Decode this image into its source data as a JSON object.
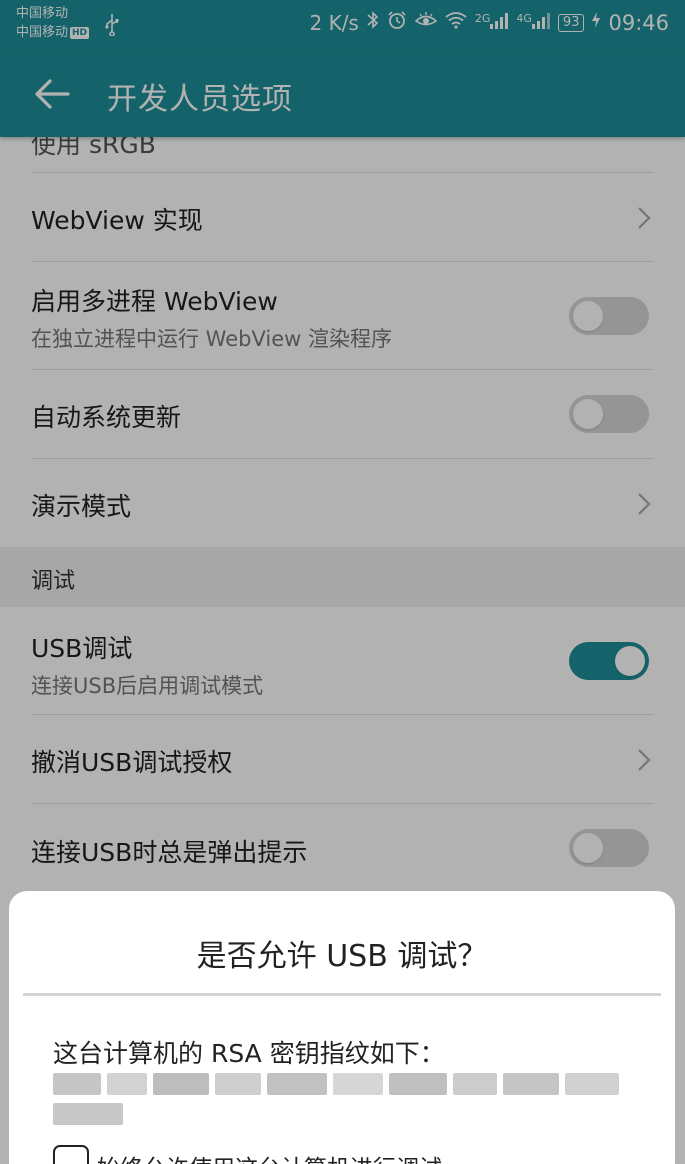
{
  "status_bar": {
    "carrier_1": "中国移动",
    "carrier_2": "中国移动",
    "hd_badge": "HD",
    "net_speed": "2 K/s",
    "signal_1_label": "2G",
    "signal_2_label": "4G",
    "battery": "93",
    "time": "09:46"
  },
  "app_bar": {
    "title": "开发人员选项"
  },
  "settings": {
    "partial_row": "使用 sRGB",
    "webview_impl": "WebView 实现",
    "multiprocess": {
      "title": "启用多进程 WebView",
      "subtitle": "在独立进程中运行 WebView 渲染程序"
    },
    "auto_update": "自动系统更新",
    "demo_mode": "演示模式",
    "debug_section": "调试",
    "usb_debug": {
      "title": "USB调试",
      "subtitle": "连接USB后启用调试模式"
    },
    "revoke_auth": "撤消USB调试授权",
    "usb_prompt": "连接USB时总是弹出提示"
  },
  "dialog": {
    "title": "是否允许 USB 调试？",
    "message": "这台计算机的 RSA 密钥指纹如下：",
    "checkbox_label": "始终允许使用这台计算机进行调试"
  },
  "colors": {
    "accent": "#1e8f98",
    "toggle_off": "#d6d6d6"
  }
}
